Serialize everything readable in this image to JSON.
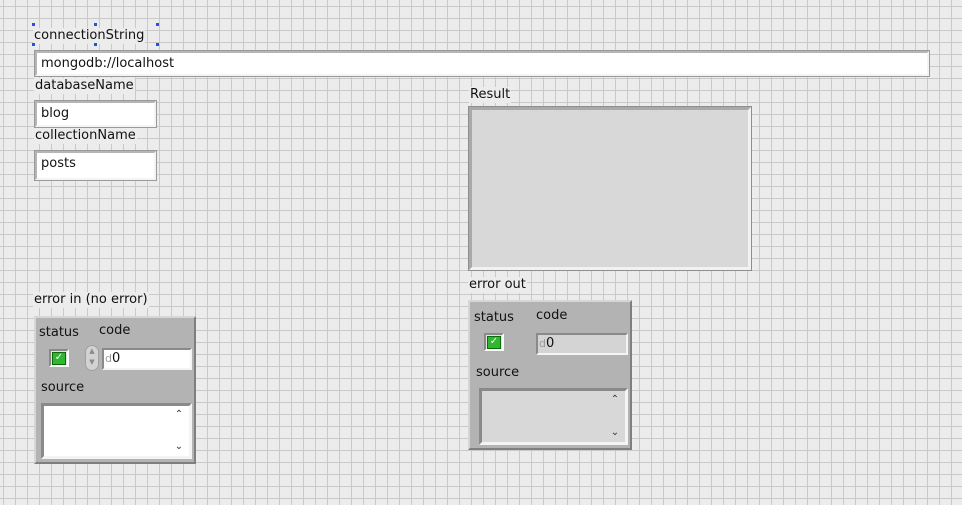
{
  "connection_string": {
    "label": "connectionString",
    "value": "mongodb://localhost"
  },
  "database_name": {
    "label": "databaseName",
    "value": "blog"
  },
  "collection_name": {
    "label": "collectionName",
    "value": "posts"
  },
  "result": {
    "label": "Result",
    "value": ""
  },
  "error_in": {
    "label": "error in (no error)",
    "status_label": "status",
    "code_label": "code",
    "source_label": "source",
    "status_value": true,
    "radix": "d",
    "code_value": "0",
    "source_value": ""
  },
  "error_out": {
    "label": "error out",
    "status_label": "status",
    "code_label": "code",
    "source_label": "source",
    "status_value": true,
    "radix": "d",
    "code_value": "0",
    "source_value": ""
  },
  "icons": {
    "status_check": "checkmark-icon",
    "spin": "increment-decrement-icon",
    "scroll_up": "scroll-up-icon",
    "scroll_down": "scroll-down-icon"
  },
  "colors": {
    "status_ok": "#2fb82f",
    "grid": "#c9c9c9",
    "panel": "#ececec",
    "selection": "#2255dd"
  }
}
